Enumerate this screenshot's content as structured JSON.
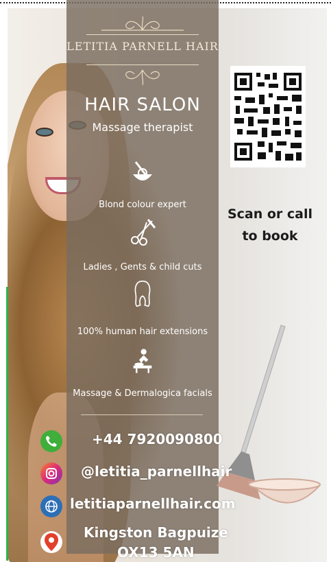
{
  "brand": "LETITIA PARNELL HAIR",
  "title": "HAIR SALON",
  "subtitle": "Massage therapist",
  "services": [
    {
      "label": "Blond colour expert",
      "icon": "hair-dye-bowl-icon"
    },
    {
      "label": "Ladies , Gents & child cuts",
      "icon": "scissors-comb-icon"
    },
    {
      "label": "100% human hair extensions",
      "icon": "hair-silhouette-icon"
    },
    {
      "label": "Massage & Dermalogica facials",
      "icon": "massage-icon"
    }
  ],
  "cta": {
    "line1": "Scan or call",
    "line2": "to book"
  },
  "contacts": {
    "phone": {
      "text": "+44 7920090800",
      "icon": "phone-icon",
      "color": "#3fae3a"
    },
    "instagram": {
      "text": "@letitia_parnellhair",
      "icon": "instagram-icon",
      "color": "#c13584"
    },
    "website": {
      "text": "letitiaparnellhair.com",
      "icon": "globe-icon",
      "color": "#2d6fb6"
    },
    "address": {
      "line1": "Kingston Bagpuize",
      "line2": "OX13 5AN",
      "icon": "location-pin-icon",
      "color": "#e2402b"
    }
  }
}
